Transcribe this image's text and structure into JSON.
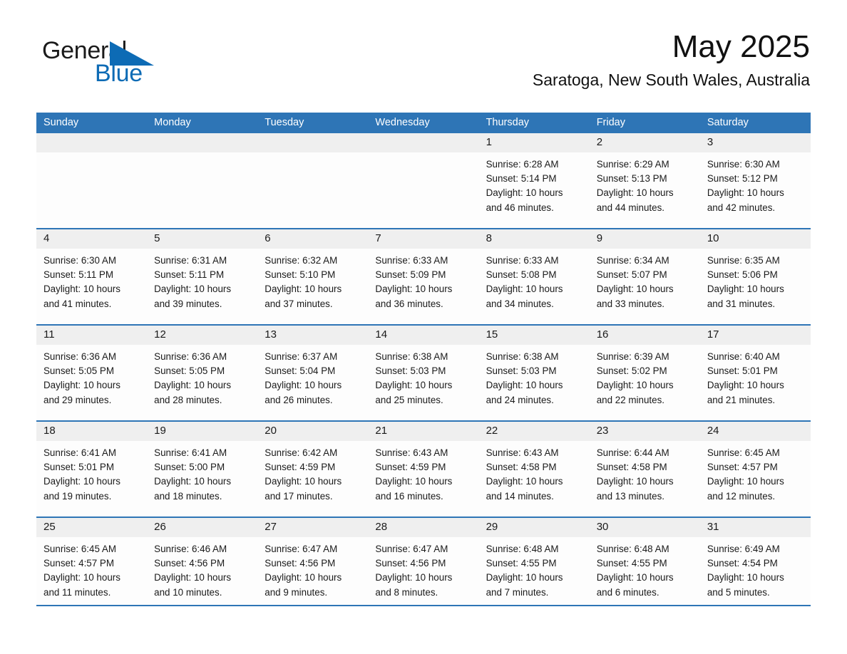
{
  "brand": {
    "name_part1": "General",
    "name_part2": "Blue",
    "logo_icon": "triangle-logo-icon",
    "accent_color": "#0d6bb5"
  },
  "header": {
    "month_title": "May 2025",
    "location": "Saratoga, New South Wales, Australia"
  },
  "calendar": {
    "header_color": "#2e75b6",
    "day_band_color": "#efefef",
    "weekdays": [
      "Sunday",
      "Monday",
      "Tuesday",
      "Wednesday",
      "Thursday",
      "Friday",
      "Saturday"
    ],
    "weeks": [
      [
        {
          "day": "",
          "sunrise": "",
          "sunset": "",
          "daylight_line1": "",
          "daylight_line2": "",
          "empty": true
        },
        {
          "day": "",
          "sunrise": "",
          "sunset": "",
          "daylight_line1": "",
          "daylight_line2": "",
          "empty": true
        },
        {
          "day": "",
          "sunrise": "",
          "sunset": "",
          "daylight_line1": "",
          "daylight_line2": "",
          "empty": true
        },
        {
          "day": "",
          "sunrise": "",
          "sunset": "",
          "daylight_line1": "",
          "daylight_line2": "",
          "empty": true
        },
        {
          "day": "1",
          "sunrise": "Sunrise: 6:28 AM",
          "sunset": "Sunset: 5:14 PM",
          "daylight_line1": "Daylight: 10 hours",
          "daylight_line2": "and 46 minutes."
        },
        {
          "day": "2",
          "sunrise": "Sunrise: 6:29 AM",
          "sunset": "Sunset: 5:13 PM",
          "daylight_line1": "Daylight: 10 hours",
          "daylight_line2": "and 44 minutes."
        },
        {
          "day": "3",
          "sunrise": "Sunrise: 6:30 AM",
          "sunset": "Sunset: 5:12 PM",
          "daylight_line1": "Daylight: 10 hours",
          "daylight_line2": "and 42 minutes."
        }
      ],
      [
        {
          "day": "4",
          "sunrise": "Sunrise: 6:30 AM",
          "sunset": "Sunset: 5:11 PM",
          "daylight_line1": "Daylight: 10 hours",
          "daylight_line2": "and 41 minutes."
        },
        {
          "day": "5",
          "sunrise": "Sunrise: 6:31 AM",
          "sunset": "Sunset: 5:11 PM",
          "daylight_line1": "Daylight: 10 hours",
          "daylight_line2": "and 39 minutes."
        },
        {
          "day": "6",
          "sunrise": "Sunrise: 6:32 AM",
          "sunset": "Sunset: 5:10 PM",
          "daylight_line1": "Daylight: 10 hours",
          "daylight_line2": "and 37 minutes."
        },
        {
          "day": "7",
          "sunrise": "Sunrise: 6:33 AM",
          "sunset": "Sunset: 5:09 PM",
          "daylight_line1": "Daylight: 10 hours",
          "daylight_line2": "and 36 minutes."
        },
        {
          "day": "8",
          "sunrise": "Sunrise: 6:33 AM",
          "sunset": "Sunset: 5:08 PM",
          "daylight_line1": "Daylight: 10 hours",
          "daylight_line2": "and 34 minutes."
        },
        {
          "day": "9",
          "sunrise": "Sunrise: 6:34 AM",
          "sunset": "Sunset: 5:07 PM",
          "daylight_line1": "Daylight: 10 hours",
          "daylight_line2": "and 33 minutes."
        },
        {
          "day": "10",
          "sunrise": "Sunrise: 6:35 AM",
          "sunset": "Sunset: 5:06 PM",
          "daylight_line1": "Daylight: 10 hours",
          "daylight_line2": "and 31 minutes."
        }
      ],
      [
        {
          "day": "11",
          "sunrise": "Sunrise: 6:36 AM",
          "sunset": "Sunset: 5:05 PM",
          "daylight_line1": "Daylight: 10 hours",
          "daylight_line2": "and 29 minutes."
        },
        {
          "day": "12",
          "sunrise": "Sunrise: 6:36 AM",
          "sunset": "Sunset: 5:05 PM",
          "daylight_line1": "Daylight: 10 hours",
          "daylight_line2": "and 28 minutes."
        },
        {
          "day": "13",
          "sunrise": "Sunrise: 6:37 AM",
          "sunset": "Sunset: 5:04 PM",
          "daylight_line1": "Daylight: 10 hours",
          "daylight_line2": "and 26 minutes."
        },
        {
          "day": "14",
          "sunrise": "Sunrise: 6:38 AM",
          "sunset": "Sunset: 5:03 PM",
          "daylight_line1": "Daylight: 10 hours",
          "daylight_line2": "and 25 minutes."
        },
        {
          "day": "15",
          "sunrise": "Sunrise: 6:38 AM",
          "sunset": "Sunset: 5:03 PM",
          "daylight_line1": "Daylight: 10 hours",
          "daylight_line2": "and 24 minutes."
        },
        {
          "day": "16",
          "sunrise": "Sunrise: 6:39 AM",
          "sunset": "Sunset: 5:02 PM",
          "daylight_line1": "Daylight: 10 hours",
          "daylight_line2": "and 22 minutes."
        },
        {
          "day": "17",
          "sunrise": "Sunrise: 6:40 AM",
          "sunset": "Sunset: 5:01 PM",
          "daylight_line1": "Daylight: 10 hours",
          "daylight_line2": "and 21 minutes."
        }
      ],
      [
        {
          "day": "18",
          "sunrise": "Sunrise: 6:41 AM",
          "sunset": "Sunset: 5:01 PM",
          "daylight_line1": "Daylight: 10 hours",
          "daylight_line2": "and 19 minutes."
        },
        {
          "day": "19",
          "sunrise": "Sunrise: 6:41 AM",
          "sunset": "Sunset: 5:00 PM",
          "daylight_line1": "Daylight: 10 hours",
          "daylight_line2": "and 18 minutes."
        },
        {
          "day": "20",
          "sunrise": "Sunrise: 6:42 AM",
          "sunset": "Sunset: 4:59 PM",
          "daylight_line1": "Daylight: 10 hours",
          "daylight_line2": "and 17 minutes."
        },
        {
          "day": "21",
          "sunrise": "Sunrise: 6:43 AM",
          "sunset": "Sunset: 4:59 PM",
          "daylight_line1": "Daylight: 10 hours",
          "daylight_line2": "and 16 minutes."
        },
        {
          "day": "22",
          "sunrise": "Sunrise: 6:43 AM",
          "sunset": "Sunset: 4:58 PM",
          "daylight_line1": "Daylight: 10 hours",
          "daylight_line2": "and 14 minutes."
        },
        {
          "day": "23",
          "sunrise": "Sunrise: 6:44 AM",
          "sunset": "Sunset: 4:58 PM",
          "daylight_line1": "Daylight: 10 hours",
          "daylight_line2": "and 13 minutes."
        },
        {
          "day": "24",
          "sunrise": "Sunrise: 6:45 AM",
          "sunset": "Sunset: 4:57 PM",
          "daylight_line1": "Daylight: 10 hours",
          "daylight_line2": "and 12 minutes."
        }
      ],
      [
        {
          "day": "25",
          "sunrise": "Sunrise: 6:45 AM",
          "sunset": "Sunset: 4:57 PM",
          "daylight_line1": "Daylight: 10 hours",
          "daylight_line2": "and 11 minutes."
        },
        {
          "day": "26",
          "sunrise": "Sunrise: 6:46 AM",
          "sunset": "Sunset: 4:56 PM",
          "daylight_line1": "Daylight: 10 hours",
          "daylight_line2": "and 10 minutes."
        },
        {
          "day": "27",
          "sunrise": "Sunrise: 6:47 AM",
          "sunset": "Sunset: 4:56 PM",
          "daylight_line1": "Daylight: 10 hours",
          "daylight_line2": "and 9 minutes."
        },
        {
          "day": "28",
          "sunrise": "Sunrise: 6:47 AM",
          "sunset": "Sunset: 4:56 PM",
          "daylight_line1": "Daylight: 10 hours",
          "daylight_line2": "and 8 minutes."
        },
        {
          "day": "29",
          "sunrise": "Sunrise: 6:48 AM",
          "sunset": "Sunset: 4:55 PM",
          "daylight_line1": "Daylight: 10 hours",
          "daylight_line2": "and 7 minutes."
        },
        {
          "day": "30",
          "sunrise": "Sunrise: 6:48 AM",
          "sunset": "Sunset: 4:55 PM",
          "daylight_line1": "Daylight: 10 hours",
          "daylight_line2": "and 6 minutes."
        },
        {
          "day": "31",
          "sunrise": "Sunrise: 6:49 AM",
          "sunset": "Sunset: 4:54 PM",
          "daylight_line1": "Daylight: 10 hours",
          "daylight_line2": "and 5 minutes."
        }
      ]
    ]
  }
}
